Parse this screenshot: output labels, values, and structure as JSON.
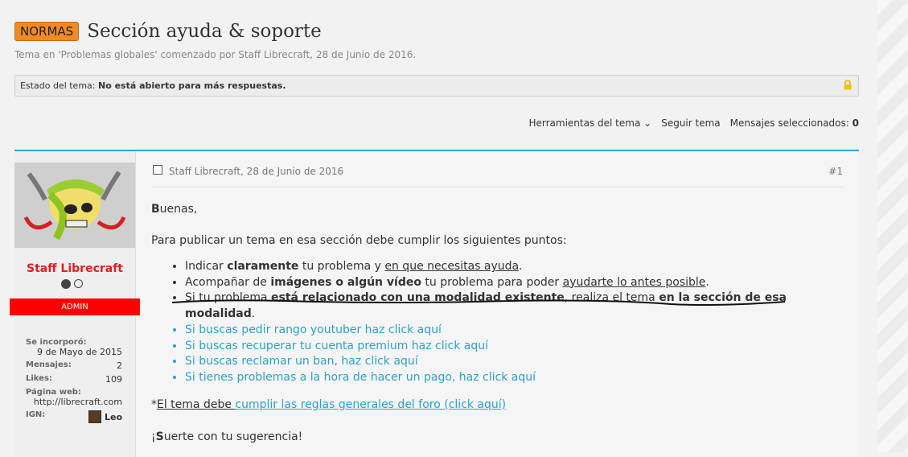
{
  "thread": {
    "prefix": "NORMAS",
    "title": "Sección ayuda & soporte",
    "subtitle": "Tema en 'Problemas globales' comenzado por Staff Librecraft, 28 de Junio de 2016."
  },
  "status": {
    "label": "Estado del tema:",
    "value": "No está abierto para más respuestas."
  },
  "tools": {
    "thread_tools": "Herramientas del tema",
    "follow": "Seguir tema",
    "selected_label": "Mensajes seleccionados:",
    "selected_count": "0"
  },
  "user": {
    "name": "Staff Librecraft",
    "role": "ADMIN",
    "joined_label": "Se incorporó:",
    "joined_value": "9 de Mayo de 2015",
    "messages_label": "Mensajes:",
    "messages_value": "2",
    "likes_label": "Likes:",
    "likes_value": "109",
    "web_label": "Página web:",
    "web_value": "http://librecraft.com",
    "ign_label": "IGN:",
    "ign_value": "Leo"
  },
  "post": {
    "author_date": "Staff Librecraft, 28 de Junio de 2016",
    "number": "#1",
    "greeting_b": "B",
    "greeting_rest": "uenas,",
    "intro": "Para publicar un tema en esa sección debe cumplir los siguientes puntos:",
    "b1a": "Indicar ",
    "b1b": "claramente",
    "b1c": " tu problema y ",
    "b1d": "en que necesitas ayuda",
    "b1e": ".",
    "b2a": "Acompañar de ",
    "b2b": "imágenes o algún vídeo",
    "b2c": " tu problema para poder ",
    "b2d": "ayudarte lo antes posible",
    "b2e": ".",
    "b3a": "Si tu problema ",
    "b3b": "está relacionado con una modalidad existente",
    "b3c": ", realiza el tema ",
    "b3d": "en la sección de esa modalidad",
    "b3e": ".",
    "link1": "Si buscas pedir rango youtuber haz click aquí",
    "link2": "Si buscas recuperar tu cuenta premium haz click aquí",
    "link3": "Si buscas reclamar un ban, haz click aquí",
    "link4": "Si tienes problemas a la hora de hacer un pago, haz click aquí",
    "note_a": "*",
    "note_b": "El tema debe ",
    "note_c": "cumplir las reglas generales del foro (click aquí)",
    "closing_a": "¡",
    "closing_b": "S",
    "closing_c": "uerte con tu sugerencia!"
  }
}
